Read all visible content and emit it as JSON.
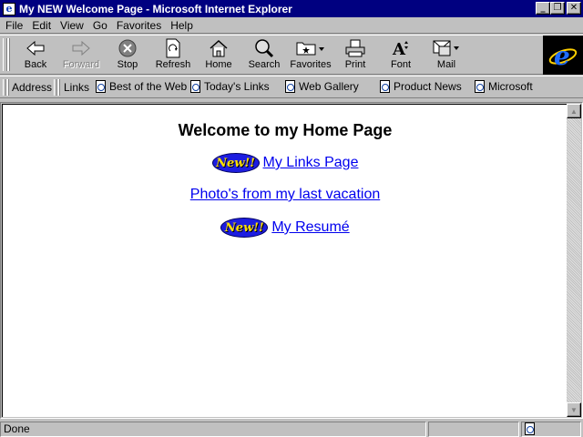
{
  "window": {
    "title": "My NEW Welcome Page - Microsoft Internet Explorer",
    "minimize_glyph": "_",
    "restore_glyph": "❐",
    "close_glyph": "✕"
  },
  "menu": [
    "File",
    "Edit",
    "View",
    "Go",
    "Favorites",
    "Help"
  ],
  "toolbar": {
    "back": "Back",
    "forward": "Forward",
    "stop": "Stop",
    "refresh": "Refresh",
    "home": "Home",
    "search": "Search",
    "favorites": "Favorites",
    "print": "Print",
    "font": "Font",
    "mail": "Mail"
  },
  "linksbar": {
    "address_label": "Address",
    "links_label": "Links",
    "items": [
      "Best of the Web",
      "Today's Links",
      "Web Gallery",
      "Product News",
      "Microsoft"
    ]
  },
  "page": {
    "heading": "Welcome to my Home Page",
    "new_badge": "New!!",
    "link_1": "My Links Page",
    "link_2": "Photo's from my last vacation",
    "link_3": "My Resumé"
  },
  "status": {
    "text": "Done"
  },
  "colors": {
    "titlebar": "#000080",
    "link": "#0000ee",
    "badge_fill": "#1d1de0",
    "badge_text": "#ffe000"
  }
}
